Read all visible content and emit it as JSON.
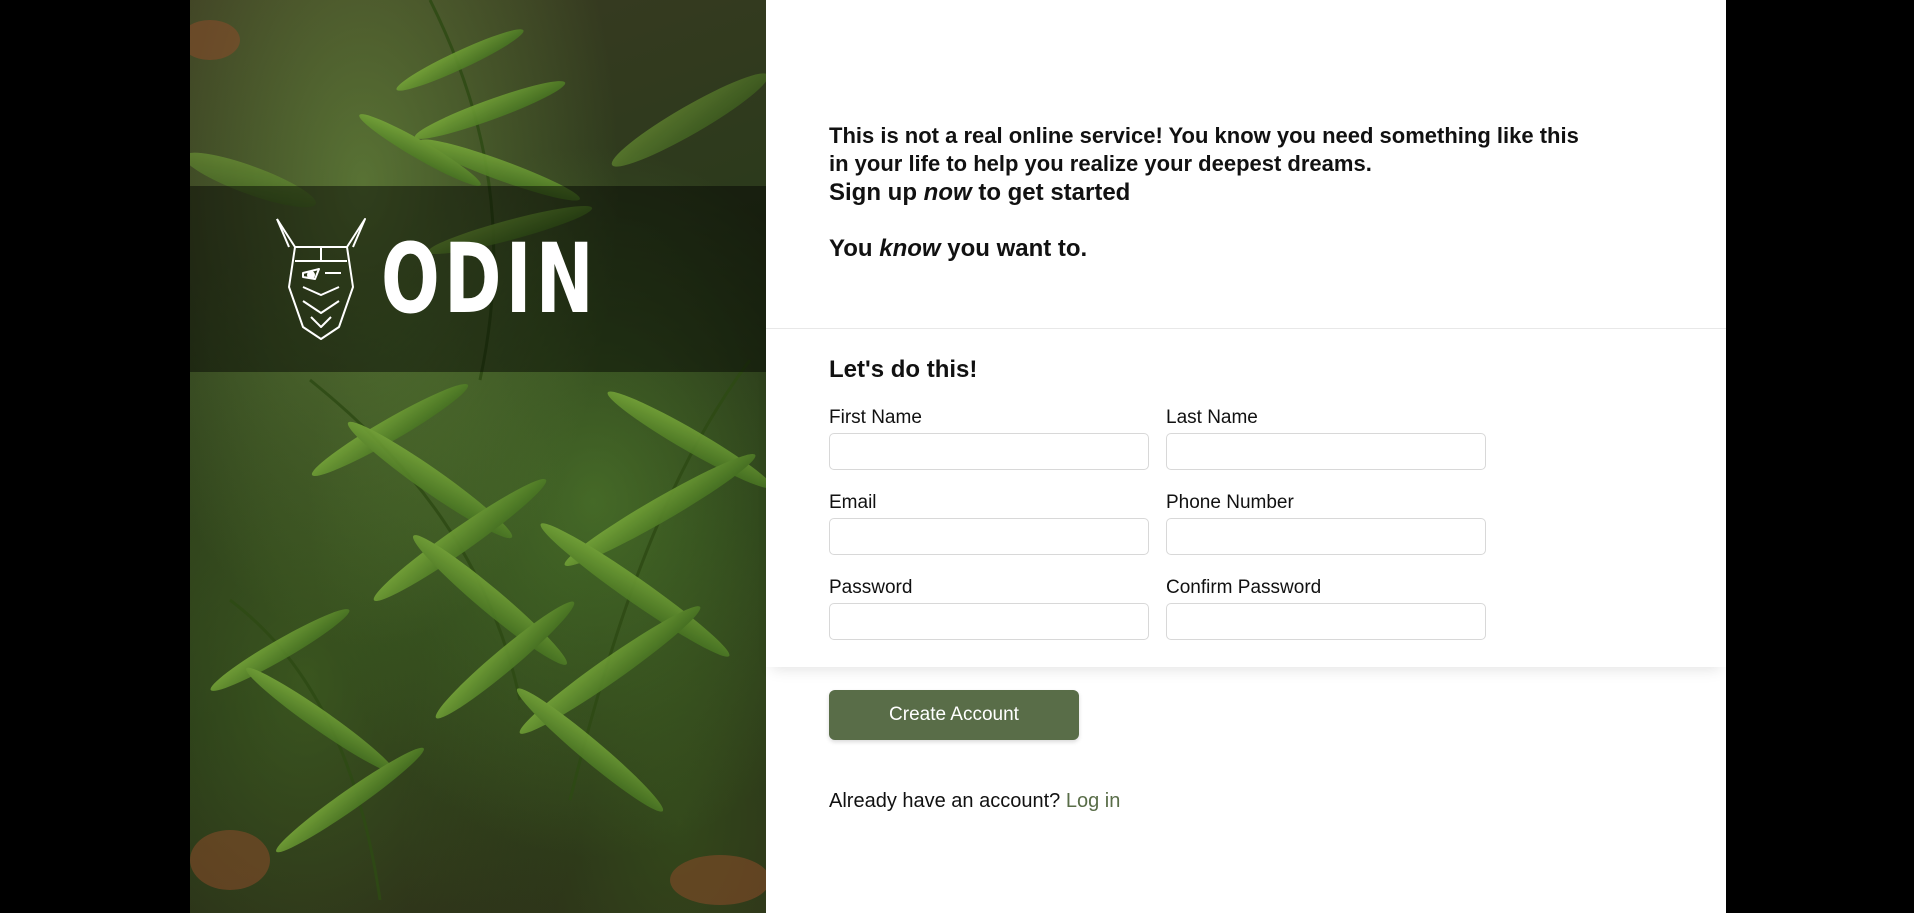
{
  "hero": {
    "logo_text": "ODIN"
  },
  "intro": {
    "lead": "This is not a real online service! You know you need something like this in your life to help you realize your deepest dreams.",
    "signup_pre": "Sign up ",
    "signup_em": "now",
    "signup_post": " to get started",
    "know_pre": "You ",
    "know_em": "know",
    "know_post": " you want to."
  },
  "form": {
    "title": "Let's do this!",
    "fields": {
      "first_name": {
        "label": "First Name",
        "value": ""
      },
      "last_name": {
        "label": "Last Name",
        "value": ""
      },
      "email": {
        "label": "Email",
        "value": ""
      },
      "phone": {
        "label": "Phone Number",
        "value": ""
      },
      "password": {
        "label": "Password",
        "value": ""
      },
      "confirm_password": {
        "label": "Confirm Password",
        "value": ""
      }
    },
    "submit_label": "Create Account"
  },
  "footer": {
    "prompt": "Already have an account?",
    "login_link": "Log in"
  },
  "colors": {
    "accent": "#596d48",
    "background": "#000000",
    "panel": "#ffffff"
  }
}
